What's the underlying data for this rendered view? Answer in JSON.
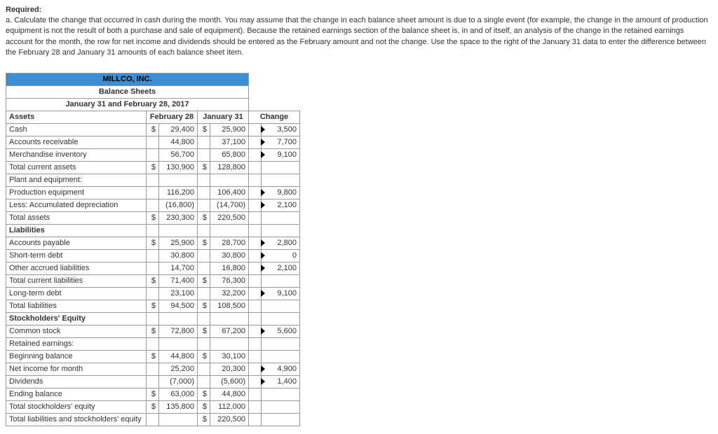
{
  "required": {
    "title": "Required:",
    "text": "a. Calculate the change that occurred in cash during the month. You may assume that the change in each balance sheet amount is due to a single event (for example, the change in the amount of production equipment is not the result of both a purchase and sale of equipment). Because the retained earnings section of the balance sheet is, in and of itself, an analysis of the change in the retained earnings account for the month, the row for net income and dividends should be entered as the February amount and not the change. Use the space to the right of the January 31 data to enter the difference between the February 28 and January 31 amounts of each balance sheet item."
  },
  "header": {
    "company": "MILLCO, INC.",
    "title": "Balance Sheets",
    "dates": "January 31 and February 28, 2017"
  },
  "cols": {
    "assets": "Assets",
    "feb": "February 28",
    "jan": "January 31",
    "change": "Change"
  },
  "rows": {
    "cash": {
      "label": "Cash",
      "fc": "$",
      "fv": "29,400",
      "jc": "$",
      "jv": "25,900",
      "ch": "3,500"
    },
    "ar": {
      "label": "Accounts receivable",
      "fv": "44,800",
      "jv": "37,100",
      "ch": "7,700"
    },
    "mi": {
      "label": "Merchandise inventory",
      "fv": "56,700",
      "jv": "65,800",
      "ch": "9,100"
    },
    "tca": {
      "label": "Total current assets",
      "fc": "$",
      "fv": "130,900",
      "jc": "$",
      "jv": "128,800"
    },
    "pe_h": {
      "label": "Plant and equipment:"
    },
    "pe": {
      "label": "Production equipment",
      "fv": "116,200",
      "jv": "106,400",
      "ch": "9,800"
    },
    "ad": {
      "label": "Less: Accumulated depreciation",
      "fv": "(16,800)",
      "jv": "(14,700)",
      "ch": "2,100"
    },
    "ta": {
      "label": "Total assets",
      "fc": "$",
      "fv": "230,300",
      "jc": "$",
      "jv": "220,500"
    },
    "liab_h": {
      "label": "Liabilities"
    },
    "ap": {
      "label": "Accounts payable",
      "fc": "$",
      "fv": "25,900",
      "jc": "$",
      "jv": "28,700",
      "ch": "2,800"
    },
    "std": {
      "label": "Short-term debt",
      "fv": "30,800",
      "jv": "30,800",
      "ch": "0"
    },
    "oal": {
      "label": "Other accrued liabilities",
      "fv": "14,700",
      "jv": "16,800",
      "ch": "2,100"
    },
    "tcl": {
      "label": "Total current liabilities",
      "fc": "$",
      "fv": "71,400",
      "jc": "$",
      "jv": "76,300"
    },
    "ltd": {
      "label": "Long-term debt",
      "fv": "23,100",
      "jv": "32,200",
      "ch": "9,100"
    },
    "tl": {
      "label": "Total liabilities",
      "fc": "$",
      "fv": "94,500",
      "jc": "$",
      "jv": "108,500"
    },
    "se_h": {
      "label": "Stockholders' Equity"
    },
    "cs": {
      "label": "Common stock",
      "fc": "$",
      "fv": "72,800",
      "jc": "$",
      "jv": "67,200",
      "ch": "5,600"
    },
    "re_h": {
      "label": "Retained earnings:"
    },
    "bb": {
      "label": "Beginning balance",
      "fc": "$",
      "fv": "44,800",
      "jc": "$",
      "jv": "30,100"
    },
    "ni": {
      "label": "Net income for month",
      "fv": "25,200",
      "jv": "20,300",
      "ch": "4,900"
    },
    "div": {
      "label": "Dividends",
      "fv": "(7,000)",
      "jv": "(5,600)",
      "ch": "1,400"
    },
    "eb": {
      "label": "Ending balance",
      "fc": "$",
      "fv": "63,000",
      "jc": "$",
      "jv": "44,800"
    },
    "tse": {
      "label": "Total stockholders' equity",
      "fc": "$",
      "fv": "135,800",
      "jc": "$",
      "jv": "112,000"
    },
    "tlse": {
      "label": "Total liabilities and stockholders' equity",
      "jc": "$",
      "jv": "220,500"
    }
  }
}
